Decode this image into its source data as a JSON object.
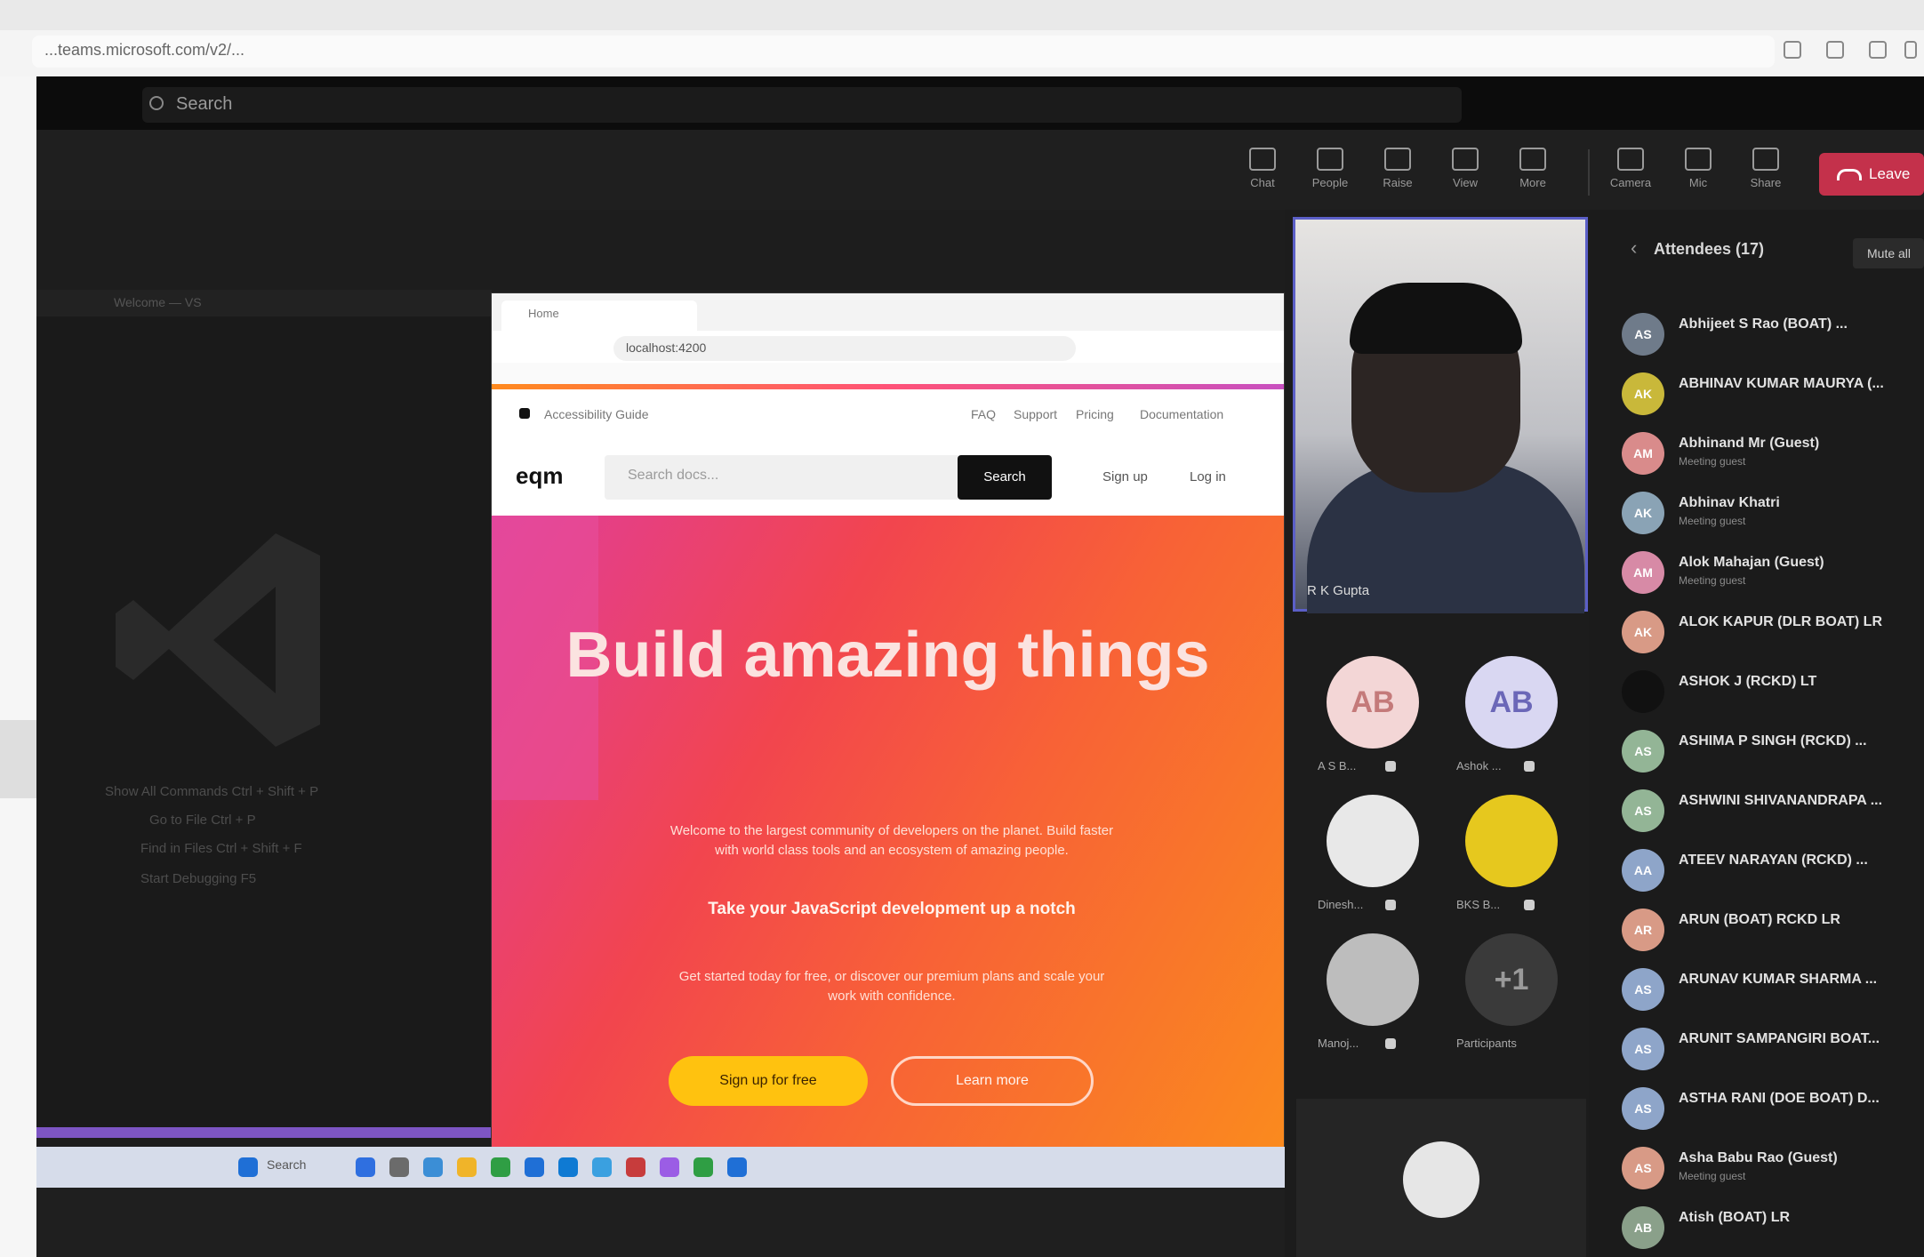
{
  "browser": {
    "url": "...teams.microsoft.com/v2/...",
    "icons": [
      "star-icon",
      "extensions-icon",
      "split-view-icon",
      "more-icon"
    ]
  },
  "teams": {
    "search_placeholder": "Search",
    "toolbar": [
      {
        "label": "Chat",
        "icon": "chat-icon"
      },
      {
        "label": "People",
        "icon": "people-icon"
      },
      {
        "label": "Raise",
        "icon": "raise-hand-icon"
      },
      {
        "label": "View",
        "icon": "view-icon"
      },
      {
        "label": "More",
        "icon": "more-icon"
      },
      {
        "label": "Camera",
        "icon": "camera-icon"
      },
      {
        "label": "Mic",
        "icon": "mic-icon"
      },
      {
        "label": "Share",
        "icon": "share-icon"
      }
    ],
    "leave_label": "Leave",
    "leave_color": "#c4314b"
  },
  "share": {
    "vscode_title": "Welcome — VS",
    "vscode_hints": [
      "Show All Commands  Ctrl + Shift + P",
      "Go to File  Ctrl + P",
      "Find in Files  Ctrl + Shift + F",
      "Start Debugging  F5"
    ],
    "inner_browser": {
      "tab_title": "Home",
      "address": "localhost:4200",
      "bar_text": "Accessibility Guide",
      "nav": [
        "FAQ",
        "Support",
        "Pricing",
        "Documentation"
      ],
      "brand": "eqm",
      "search_placeholder": "Search docs...",
      "search_button": "Search",
      "links": [
        "Sign up",
        "Log in"
      ],
      "hero_title": "Build amazing things",
      "hero_sub": "Welcome to the largest community of developers on the planet. Build faster with world class tools and an ecosystem of amazing people.",
      "hero_sub2": "Take your JavaScript development up a notch",
      "hero_sub3": "Get started today for free, or discover our premium plans and scale your work with confidence.",
      "cta_primary": "Sign up for free",
      "cta_secondary": "Learn more"
    },
    "taskbar_search": "Search"
  },
  "video": {
    "presenter_name": "R K Gupta",
    "tiles": [
      {
        "initials": "AB",
        "name": "A S B...",
        "bg": "#f3d6d6",
        "fg": "#c47a7a"
      },
      {
        "initials": "AB",
        "name": "Ashok ...",
        "bg": "#d9d7f2",
        "fg": "#6b67b8"
      },
      {
        "initials": "",
        "name": "Dinesh...",
        "bg": "#e8e8e8",
        "fg": "#333"
      },
      {
        "initials": "",
        "name": "BKS B...",
        "bg": "#e6c81e",
        "fg": "#333"
      },
      {
        "initials": "",
        "name": "Manoj...",
        "bg": "#bdbdbd",
        "fg": "#333"
      },
      {
        "initials": "+1",
        "name": "Participants",
        "bg": "#3a3a3a",
        "fg": "#9a9a9a"
      }
    ]
  },
  "people": {
    "title": "Attendees (17)",
    "button": "Mute all",
    "list": [
      {
        "initials": "AS",
        "name": "Abhijeet S Rao (BOAT) ...",
        "sub": "",
        "color": "#6f7b8a"
      },
      {
        "initials": "AK",
        "name": "ABHINAV KUMAR MAURYA (...",
        "sub": "",
        "color": "#c9b83a"
      },
      {
        "initials": "AM",
        "name": "Abhinand Mr (Guest)",
        "sub": "Meeting guest",
        "color": "#d98b8b"
      },
      {
        "initials": "AK",
        "name": "Abhinav Khatri",
        "sub": "Meeting guest",
        "color": "#8aa3b5"
      },
      {
        "initials": "AM",
        "name": "Alok Mahajan (Guest)",
        "sub": "Meeting guest",
        "color": "#d78aa6"
      },
      {
        "initials": "AK",
        "name": "ALOK KAPUR (DLR BOAT) LR",
        "sub": "",
        "color": "#d89a86"
      },
      {
        "initials": "",
        "name": "ASHOK J (RCKD) LT",
        "sub": "",
        "color": "#111111"
      },
      {
        "initials": "AS",
        "name": "ASHIMA P SINGH (RCKD) ...",
        "sub": "",
        "color": "#93b596"
      },
      {
        "initials": "AS",
        "name": "ASHWINI SHIVANANDRAPA ...",
        "sub": "",
        "color": "#93b596"
      },
      {
        "initials": "AA",
        "name": "ATEEV NARAYAN (RCKD) ...",
        "sub": "",
        "color": "#8ea5c9"
      },
      {
        "initials": "AR",
        "name": "ARUN (BOAT) RCKD LR",
        "sub": "",
        "color": "#d89a86"
      },
      {
        "initials": "AS",
        "name": "ARUNAV KUMAR SHARMA ...",
        "sub": "",
        "color": "#8ea5c9"
      },
      {
        "initials": "AS",
        "name": "ARUNIT SAMPANGIRI BOAT...",
        "sub": "",
        "color": "#8ea5c9"
      },
      {
        "initials": "AS",
        "name": "ASTHA RANI (DOE BOAT) D...",
        "sub": "",
        "color": "#8ea5c9"
      },
      {
        "initials": "AS",
        "name": "Asha Babu Rao (Guest)",
        "sub": "Meeting guest",
        "color": "#d89a86"
      },
      {
        "initials": "AB",
        "name": "Atish (BOAT) LR",
        "sub": "",
        "color": "#8aa08a"
      }
    ]
  }
}
